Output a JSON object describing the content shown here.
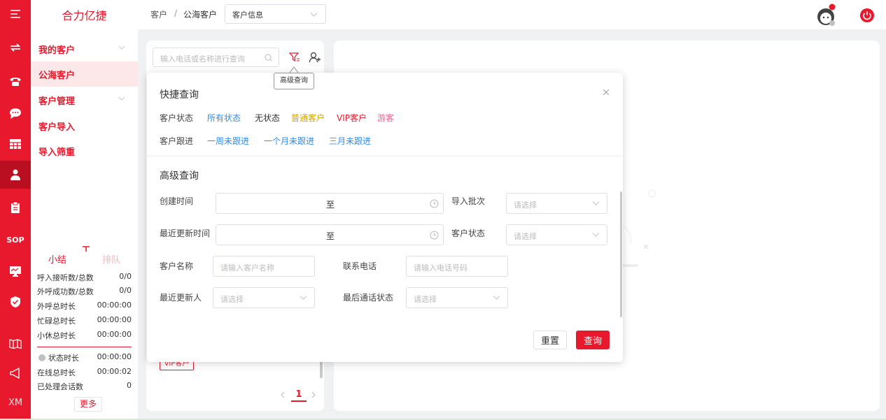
{
  "app": {
    "logo": "合力亿捷"
  },
  "rail": {
    "items": [
      "menu-icon",
      "transfer-icon",
      "phone-icon",
      "chat-icon",
      "grid-icon",
      "user-icon",
      "clipboard-icon",
      "SOP",
      "monitor-icon",
      "shield-icon",
      "book-icon",
      "megaphone-icon",
      "XM"
    ],
    "sop_label": "SOP",
    "xm_label": "XM"
  },
  "sidebar": {
    "items": [
      {
        "label": "我的客户",
        "expandable": true
      },
      {
        "label": "公海客户",
        "active": true
      },
      {
        "label": "客户管理",
        "expandable": true
      },
      {
        "label": "客户导入"
      },
      {
        "label": "导入筛重"
      }
    ]
  },
  "summary": {
    "tabs": [
      "小结",
      "排队"
    ],
    "rows": [
      {
        "label": "呼入接听数/总数",
        "value": "0/0"
      },
      {
        "label": "外呼成功数/总数",
        "value": "0/0"
      },
      {
        "label": "外呼总时长",
        "value": "00:00:00"
      },
      {
        "label": "忙碌总时长",
        "value": "00:00:00"
      },
      {
        "label": "小休总时长",
        "value": "00:00:00"
      },
      {
        "label": "状态时长",
        "value": "00:00:00"
      },
      {
        "label": "在线总时长",
        "value": "00:00:02"
      },
      {
        "label": "已处理会话数",
        "value": "0"
      }
    ],
    "more_label": "更多"
  },
  "header": {
    "breadcrumb": [
      "客户",
      "公海客户"
    ],
    "separator": "/",
    "select_value": "客户信息"
  },
  "list_panel": {
    "search_placeholder": "输入电话或名称进行查询",
    "filter_tooltip": "高级查询",
    "tag": "VIP客户",
    "page": "1"
  },
  "popup": {
    "quick_title": "快捷查询",
    "status_label": "客户状态",
    "status_options": [
      {
        "text": "所有状态",
        "color": "#2d8cf0"
      },
      {
        "text": "无状态",
        "color": "#333333"
      },
      {
        "text": "普通客户",
        "color": "#d4a400"
      },
      {
        "text": "VIP客户",
        "color": "#e8192c"
      },
      {
        "text": "游客",
        "color": "#f06292"
      }
    ],
    "follow_label": "客户跟进",
    "follow_options": [
      "一周未跟进",
      "一个月未跟进",
      "三月未跟进"
    ],
    "adv_title": "高级查询",
    "fields": {
      "create_time": {
        "label": "创建时间",
        "to": "至"
      },
      "update_time": {
        "label": "最近更新时间",
        "to": "至"
      },
      "import_batch": {
        "label": "导入批次",
        "placeholder": "请选择"
      },
      "cust_status": {
        "label": "客户状态",
        "placeholder": "请选择"
      },
      "cust_name": {
        "label": "客户名称",
        "placeholder": "请输入客户名称"
      },
      "phone": {
        "label": "联系电话",
        "placeholder": "请输入电话号码"
      },
      "updater": {
        "label": "最近更新人",
        "placeholder": "请选择"
      },
      "call_status": {
        "label": "最后通话状态",
        "placeholder": "请选择"
      }
    },
    "reset_label": "重置",
    "query_label": "查询"
  },
  "colors": {
    "brand": "#e8192c",
    "link": "#2d8cf0"
  }
}
